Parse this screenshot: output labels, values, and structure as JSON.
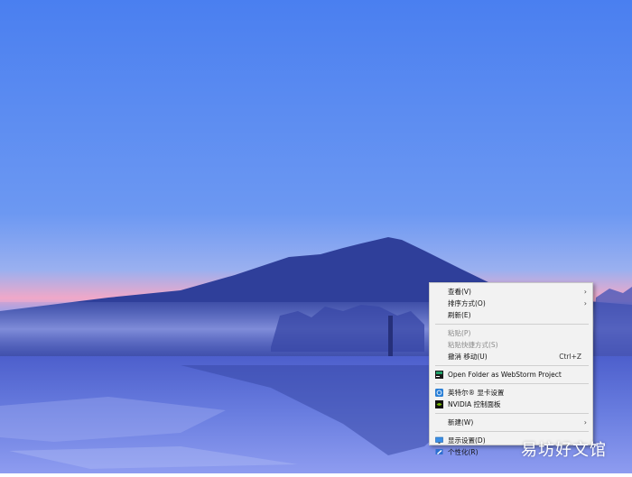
{
  "menu": {
    "items": [
      {
        "label": "查看(V)",
        "submenu": true
      },
      {
        "label": "排序方式(O)",
        "submenu": true
      },
      {
        "label": "刷新(E)"
      },
      {
        "label": "粘贴(P)",
        "disabled": true
      },
      {
        "label": "粘贴快捷方式(S)",
        "disabled": true
      },
      {
        "label": "撤消 移动(U)",
        "shortcut": "Ctrl+Z"
      },
      {
        "label": "Open Folder as WebStorm Project",
        "icon": "webstorm-icon"
      },
      {
        "label": "英特尔® 显卡设置",
        "icon": "intel-graphics-icon"
      },
      {
        "label": "NVIDIA 控制面板",
        "icon": "nvidia-icon"
      },
      {
        "label": "新建(W)",
        "submenu": true
      },
      {
        "label": "显示设置(D)",
        "icon": "display-settings-icon"
      },
      {
        "label": "个性化(R)",
        "icon": "personalize-icon"
      }
    ],
    "arrow_glyph": "›"
  },
  "watermark": "易坊好文馆",
  "colors": {
    "sky_top": "#4a7ff0",
    "sky_mid": "#7aa0f0",
    "horizon": "#f0a8c8",
    "mountain": "#2f3f9a",
    "water": "#5a6ed8",
    "menu_bg": "#f2f2f2"
  }
}
